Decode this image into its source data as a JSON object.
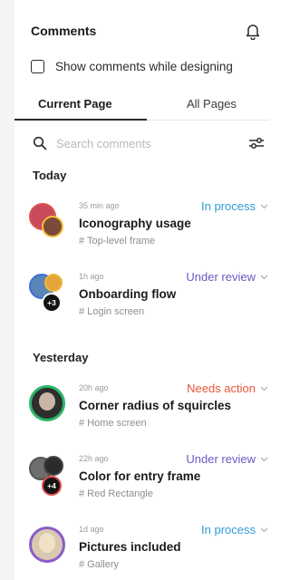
{
  "header": {
    "title": "Comments"
  },
  "options": {
    "show_while_designing_label": "Show comments while designing"
  },
  "tabs": [
    {
      "label": "Current Page"
    },
    {
      "label": "All Pages"
    }
  ],
  "search": {
    "placeholder": "Search comments"
  },
  "sections": [
    {
      "label": "Today",
      "comments": [
        {
          "time": "35 min ago",
          "status": "In process",
          "status_color": "#2f9bd6",
          "title": "Iconography usage",
          "frame": "# Top-level frame"
        },
        {
          "time": "1h ago",
          "status": "Under review",
          "status_color": "#6b58c7",
          "title": "Onboarding flow",
          "frame": "# Login screen",
          "extra_count": "+3"
        }
      ]
    },
    {
      "label": "Yesterday",
      "comments": [
        {
          "time": "20h ago",
          "status": "Needs action",
          "status_color": "#e8563a",
          "title": "Corner radius of squircles",
          "frame": "# Home screen"
        },
        {
          "time": "22h ago",
          "status": "Under review",
          "status_color": "#6b58c7",
          "title": "Color for entry frame",
          "frame": "# Red Rectangle",
          "extra_count": "+4"
        },
        {
          "time": "1d ago",
          "status": "In process",
          "status_color": "#2f9bd6",
          "title": "Pictures included",
          "frame": "# Gallery"
        }
      ]
    }
  ]
}
